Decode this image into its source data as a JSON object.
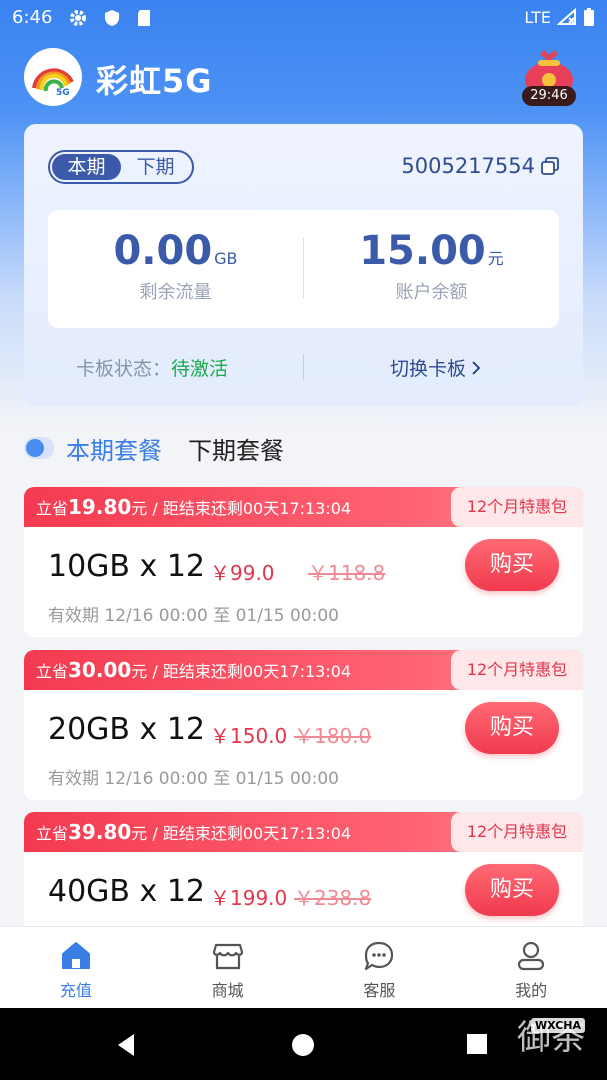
{
  "status_bar": {
    "time": "6:46",
    "network": "LTE"
  },
  "header": {
    "title": "彩虹5G",
    "logo_text": "5G",
    "gift_timer": "29:46"
  },
  "account": {
    "period_tabs": [
      "本期",
      "下期"
    ],
    "phone_number": "5005217554",
    "data_remaining": {
      "value": "0.00",
      "unit": "GB",
      "label": "剩余流量"
    },
    "balance": {
      "value": "15.00",
      "unit": "元",
      "label": "账户余额"
    },
    "card_status_label": "卡板状态：",
    "card_status_value": "待激活",
    "switch_card": "切换卡板"
  },
  "package_tabs": {
    "current": "本期套餐",
    "next": "下期套餐"
  },
  "packages": [
    {
      "save_prefix": "立省",
      "save_amount": "19.80",
      "save_suffix": "元 / 距结束还剩00天17:13:04",
      "badge": "12个月特惠包",
      "name": "10GB x 12",
      "price": "￥99.0",
      "original_price": "￥118.8",
      "buy": "购买",
      "validity": "有效期 12/16 00:00 至 01/15 00:00"
    },
    {
      "save_prefix": "立省",
      "save_amount": "30.00",
      "save_suffix": "元 / 距结束还剩00天17:13:04",
      "badge": "12个月特惠包",
      "name": "20GB x 12",
      "price": "￥150.0",
      "original_price": "￥180.0",
      "buy": "购买",
      "validity": "有效期 12/16 00:00 至 01/15 00:00"
    },
    {
      "save_prefix": "立省",
      "save_amount": "39.80",
      "save_suffix": "元 / 距结束还剩00天17:13:04",
      "badge": "12个月特惠包",
      "name": "40GB x 12",
      "price": "￥199.0",
      "original_price": "￥238.8",
      "buy": "购买",
      "validity": ""
    }
  ],
  "bottom_nav": [
    {
      "label": "充值",
      "icon": "home-icon",
      "active": true
    },
    {
      "label": "商城",
      "icon": "store-icon",
      "active": false
    },
    {
      "label": "客服",
      "icon": "chat-icon",
      "active": false
    },
    {
      "label": "我的",
      "icon": "user-icon",
      "active": false
    }
  ],
  "watermark": {
    "text": "御茶",
    "tag": "WXCHA"
  },
  "colors": {
    "primary": "#3b5aa9",
    "accent": "#3a7ee6",
    "sale": "#f03a4e",
    "success": "#1aaa4b"
  }
}
